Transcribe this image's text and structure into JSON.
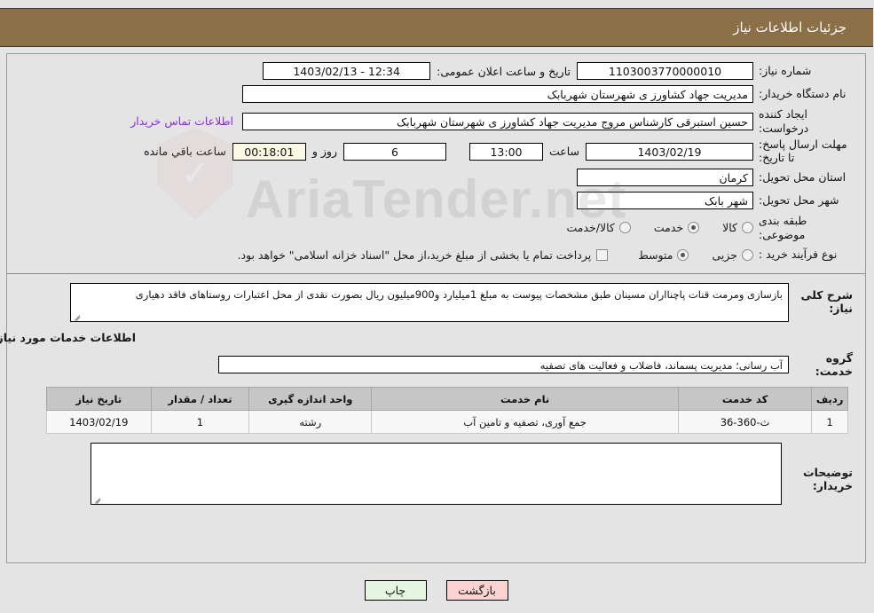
{
  "header": {
    "title": "جزئیات اطلاعات نیاز"
  },
  "form": {
    "need_number_label": "شماره نیاز:",
    "need_number_value": "1103003770000010",
    "announce_datetime_label": "تاریخ و ساعت اعلان عمومی:",
    "announce_datetime_value": "12:34 - 1403/02/13",
    "buyer_org_label": "نام دستگاه خریدار:",
    "buyer_org_value": "مدیریت جهاد کشاورز ی شهرستان شهربابک",
    "creator_label": "ایجاد کننده درخواست:",
    "creator_value": "حسین استبرقی کارشناس مروج مدیریت جهاد کشاورز ی شهرستان شهربابک",
    "contact_link": "اطلاعات تماس خریدار",
    "deadline_label": "مهلت ارسال پاسخ: تا تاریخ:",
    "deadline_date": "1403/02/19",
    "hour_word": "ساعت",
    "deadline_time": "13:00",
    "remaining_days": "6",
    "days_and_word": "روز و",
    "remaining_clock": "00:18:01",
    "remaining_suffix": "ساعت باقي مانده",
    "province_label": "استان محل تحویل:",
    "province_value": "کرمان",
    "city_label": "شهر محل تحویل:",
    "city_value": "شهر بابک",
    "category_label": "طبقه بندی موضوعی:",
    "category_options": [
      {
        "label": "کالا",
        "checked": false
      },
      {
        "label": "خدمت",
        "checked": true
      },
      {
        "label": "کالا/خدمت",
        "checked": false
      }
    ],
    "process_label": "نوع فرآیند خرید :",
    "process_options": [
      {
        "label": "جزیی",
        "checked": false
      },
      {
        "label": "متوسط",
        "checked": true
      }
    ],
    "treasury_checkbox_checked": false,
    "treasury_text": "پرداخت تمام یا بخشی از مبلغ خرید،از محل \"اسناد خزانه اسلامی\" خواهد بود."
  },
  "description": {
    "label": "شرح کلی نیاز:",
    "value": "بازسازی ومرمت قنات پاچنااران مسینان طبق مشخصات پیوست به مبلغ 1میلیارد و900میلیون ریال بصورت نقدی از محل اعتبارات روستاهای فاقد دهیاری"
  },
  "services_section": {
    "title": "اطلاعات خدمات مورد نیاز",
    "group_label": "گروه خدمت:",
    "group_value": "آب رسانی؛ مدیریت پسماند، فاضلاب و فعالیت های تصفیه"
  },
  "table": {
    "columns": [
      "ردیف",
      "کد خدمت",
      "نام خدمت",
      "واحد اندازه گیری",
      "تعداد / مقدار",
      "تاریخ نیاز"
    ],
    "rows": [
      {
        "radif": "1",
        "code": "ث-360-36",
        "name": "جمع آوری، تصفیه و تامین آب",
        "unit": "رشته",
        "qty": "1",
        "date": "1403/02/19"
      }
    ]
  },
  "buyer_notes": {
    "label": "توضیحات خریدار:",
    "value": ""
  },
  "footer": {
    "print_label": "چاپ",
    "back_label": "بازگشت"
  },
  "watermark": {
    "text": "AriaTender.net"
  },
  "colors": {
    "header_bg": "#8b6f47",
    "page_bg": "#e4e4e4",
    "link": "#8a2be2",
    "timer_bg": "#fbf8e3",
    "back_btn_bg": "#fcd2d2",
    "print_btn_bg": "#e6f5e0",
    "table_header_bg": "#c6c6c6"
  }
}
